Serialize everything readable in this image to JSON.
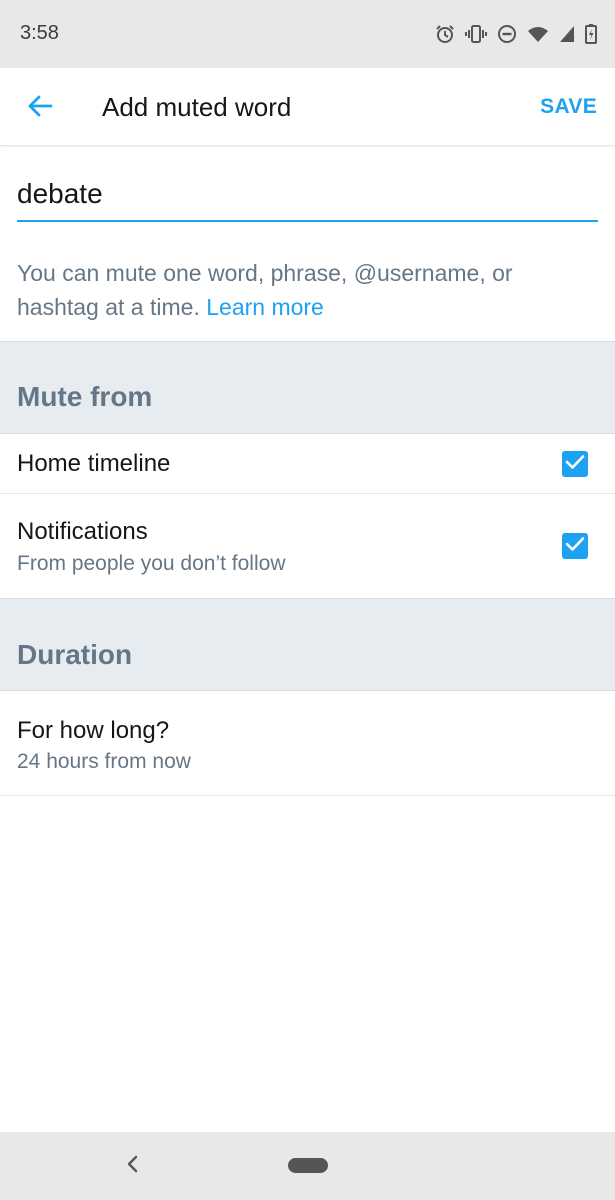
{
  "status_bar": {
    "time": "3:58",
    "icons": [
      "alarm-icon",
      "vibrate-icon",
      "do-not-disturb-icon",
      "wifi-icon",
      "signal-icon",
      "battery-icon"
    ]
  },
  "app_bar": {
    "title": "Add muted word",
    "save_label": "SAVE",
    "back_icon": "arrow-left-icon"
  },
  "word_input": {
    "value": "debate"
  },
  "hint": {
    "text": "You can mute one word, phrase, @username, or hashtag at a time.",
    "link": "Learn more"
  },
  "mute_from": {
    "title": "Mute from",
    "options": [
      {
        "label": "Home timeline",
        "sublabel": "",
        "checked": true
      },
      {
        "label": "Notifications",
        "sublabel": "From people you don’t follow",
        "checked": true
      }
    ]
  },
  "duration": {
    "title": "Duration",
    "label": "For how long?",
    "value": "24 hours from now"
  },
  "colors": {
    "accent": "#1da1f2",
    "secondary_text": "#657786",
    "section_bg": "#e6ecf0"
  },
  "nav_bar": {
    "icons": [
      "nav-back-icon",
      "home-pill-icon"
    ]
  }
}
